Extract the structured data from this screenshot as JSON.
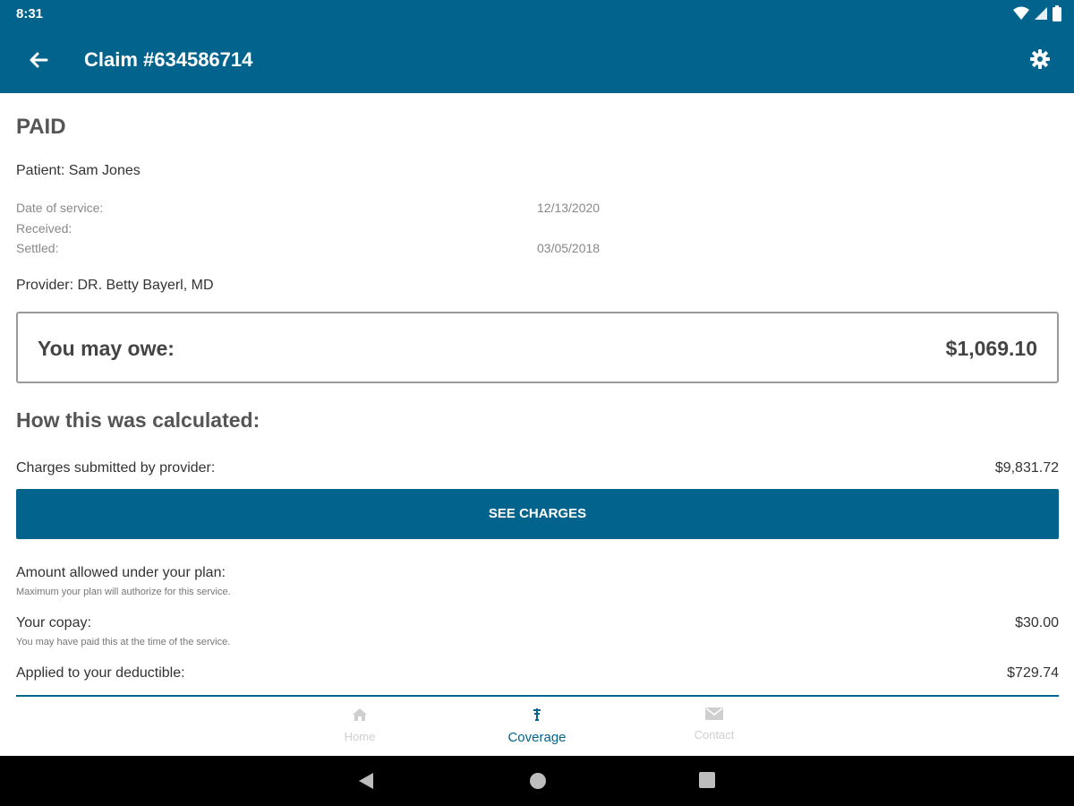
{
  "statusbar": {
    "time": "8:31"
  },
  "appbar": {
    "title": "Claim #634586714"
  },
  "claim": {
    "status": "PAID",
    "patient": "Patient: Sam Jones",
    "dates": [
      {
        "label": "Date of service:",
        "value": "12/13/2020"
      },
      {
        "label": "Received:",
        "value": ""
      },
      {
        "label": "Settled:",
        "value": "03/05/2018"
      }
    ],
    "provider": "Provider: DR. Betty Bayerl, MD"
  },
  "owe": {
    "label": "You may owe:",
    "value": "$1,069.10"
  },
  "calculation": {
    "heading": "How this was calculated:",
    "charges": {
      "label": "Charges submitted by provider:",
      "value": "$9,831.72"
    },
    "see_charges_label": "SEE CHARGES",
    "allowed": {
      "label": "Amount allowed under your plan:",
      "sub": "Maximum your plan will authorize for this service.",
      "value": ""
    },
    "copay": {
      "label": "Your copay:",
      "sub": "You may have paid this at the time of the service.",
      "value": "$30.00"
    },
    "deductible": {
      "label": "Applied to your deductible:",
      "value": "$729.74"
    }
  },
  "bottom_nav": [
    {
      "label": "Home",
      "icon": "home-icon",
      "active": false
    },
    {
      "label": "Coverage",
      "icon": "coverage-icon",
      "active": true
    },
    {
      "label": "Contact",
      "icon": "mail-icon",
      "active": false
    }
  ],
  "colors": {
    "primary": "#02648c",
    "inactive_nav": "#cfcfcf"
  }
}
